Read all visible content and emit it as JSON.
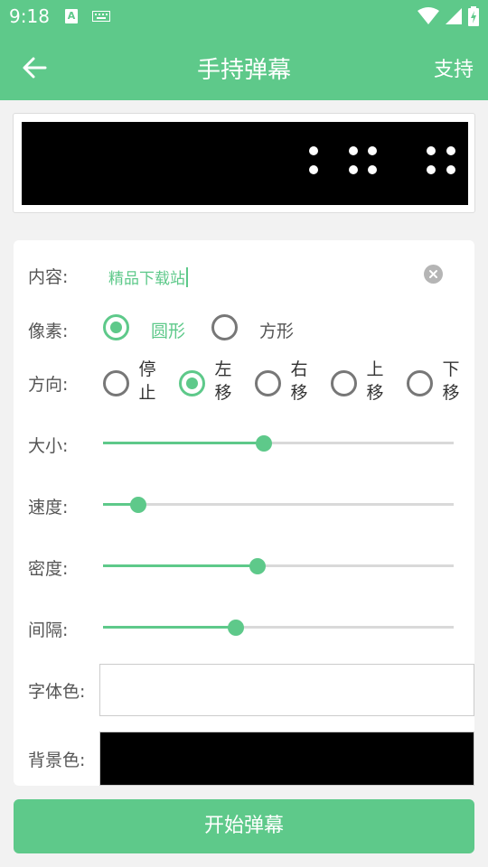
{
  "status": {
    "time": "9:18",
    "a_badge": "A"
  },
  "header": {
    "title": "手持弹幕",
    "support": "支持"
  },
  "form": {
    "content": {
      "label": "内容:",
      "value": "精品下载站"
    },
    "pixel": {
      "label": "像素:",
      "options": [
        "圆形",
        "方形"
      ],
      "selected": "圆形"
    },
    "direction": {
      "label": "方向:",
      "options": [
        {
          "line1": "停",
          "line2": "止"
        },
        {
          "line1": "左",
          "line2": "移"
        },
        {
          "line1": "右",
          "line2": "移"
        },
        {
          "line1": "上",
          "line2": "移"
        },
        {
          "line1": "下",
          "line2": "移"
        }
      ],
      "selected_index": 1
    },
    "size": {
      "label": "大小:",
      "value": 0.46
    },
    "speed": {
      "label": "速度:",
      "value": 0.1
    },
    "density": {
      "label": "密度:",
      "value": 0.44
    },
    "interval": {
      "label": "间隔:",
      "value": 0.38
    },
    "font_color": {
      "label": "字体色:",
      "color": "#ffffff"
    },
    "bg_color": {
      "label": "背景色:",
      "color": "#000000"
    }
  },
  "start_button": "开始弹幕",
  "colors": {
    "accent": "#5ec98a"
  }
}
